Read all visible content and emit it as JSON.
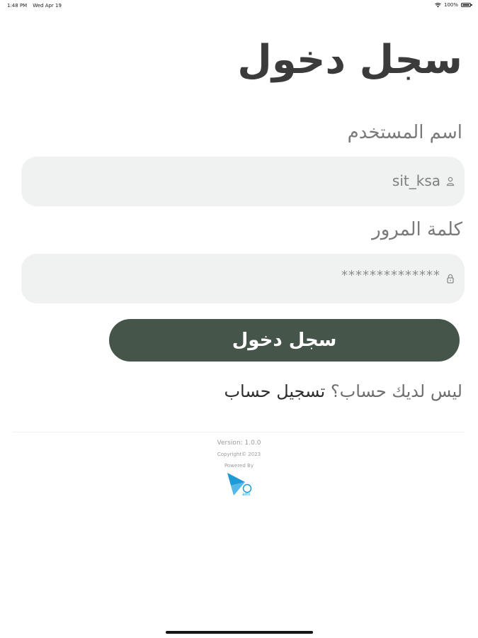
{
  "status_bar": {
    "time": "1:48 PM",
    "date": "Wed Apr 19",
    "battery_percent": "100%"
  },
  "login": {
    "title": "سجل دخول",
    "username_label": "اسم المستخدم",
    "username_value": "sit_ksa",
    "password_label": "كلمة المرور",
    "password_value": "**************",
    "submit_label": "سجل دخول",
    "no_account_text": "ليس لديك حساب؟",
    "register_link": "تسجيل حساب"
  },
  "footer": {
    "version": "Version: 1.0.0",
    "copyright": "Copyright© 2023",
    "powered_by": "Powered By",
    "logo_text": "ami"
  },
  "colors": {
    "primary_button": "#455549",
    "input_background": "#eff2f1",
    "logo_blue": "#1e9ad6"
  }
}
